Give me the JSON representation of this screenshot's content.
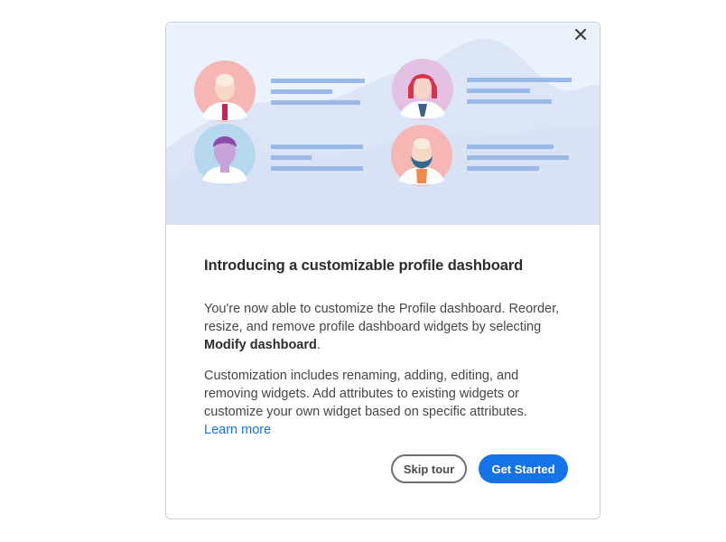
{
  "dialog": {
    "close_label": "×",
    "title": "Introducing a customizable profile dashboard",
    "paragraph1_text": "You're now able to customize the Profile dashboard. Reorder, resize, and remove profile dashboard widgets by selecting ",
    "paragraph1_bold": "Modify dashboard",
    "paragraph1_end": ".",
    "paragraph2_text": "Customization includes renaming, adding, editing, and removing widgets. Add attributes to existing widgets or customize your own widget based on specific attributes.",
    "learn_more": "Learn more",
    "skip_button": "Skip tour",
    "start_button": "Get Started"
  },
  "colors": {
    "accent": "#1473e6",
    "hero_background": "#eaf2fd",
    "line_blue": "#9ab8e8"
  },
  "illustration": {
    "avatars": [
      "avatar-bald-man-icon",
      "avatar-red-hair-woman-icon",
      "avatar-purple-hair-person-icon",
      "avatar-bearded-man-icon"
    ]
  }
}
